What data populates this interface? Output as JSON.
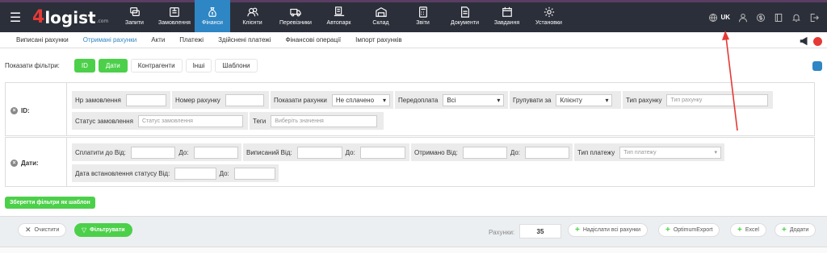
{
  "app": {
    "logo_prefix": "4",
    "logo_name": "logist",
    "logo_suffix": ".com"
  },
  "nav": [
    {
      "label": "Запити",
      "icon": "requests-icon"
    },
    {
      "label": "Замовлення",
      "icon": "orders-icon"
    },
    {
      "label": "Фінанси",
      "icon": "money-bag-icon",
      "active": true
    },
    {
      "label": "Клієнти",
      "icon": "users-icon"
    },
    {
      "label": "Перевізники",
      "icon": "truck-icon"
    },
    {
      "label": "Автопарк",
      "icon": "fleet-icon"
    },
    {
      "label": "Склад",
      "icon": "warehouse-icon"
    },
    {
      "label": "Звіти",
      "icon": "calculator-icon"
    },
    {
      "label": "Документи",
      "icon": "document-icon"
    },
    {
      "label": "Завдання",
      "icon": "calendar-icon"
    },
    {
      "label": "Установки",
      "icon": "gear-icon"
    }
  ],
  "lang": "UK",
  "subnav": [
    {
      "label": "Виписані рахунки"
    },
    {
      "label": "Отримані рахунки",
      "active": true
    },
    {
      "label": "Акти"
    },
    {
      "label": "Платежі"
    },
    {
      "label": "Здійснені платежі"
    },
    {
      "label": "Фінансові операції"
    },
    {
      "label": "Імпорт рахунків"
    }
  ],
  "filters": {
    "label": "Показати фільтри:",
    "chips": [
      {
        "label": "ID",
        "on": true
      },
      {
        "label": "Дати",
        "on": true
      },
      {
        "label": "Контрагенти"
      },
      {
        "label": "Інші"
      },
      {
        "label": "Шаблони"
      }
    ]
  },
  "id_panel": {
    "title": "ID:",
    "order_no_label": "Нр замовлення",
    "invoice_no_label": "Номер рахунку",
    "show_invoices_label": "Показати рахунки",
    "show_invoices_value": "Не сплачено",
    "prepay_label": "Передоплата",
    "prepay_value": "Всі",
    "group_by_label": "Групувати за",
    "group_by_value": "Клієнту",
    "invoice_type_label": "Тип рахунку",
    "invoice_type_placeholder": "Тип рахунку",
    "order_status_label": "Статус замовлення",
    "order_status_placeholder": "Статус замовлення",
    "tags_label": "Теги",
    "tags_placeholder": "Виберіть значення"
  },
  "dates_panel": {
    "title": "Дати:",
    "paid_until_label": "Сплатити до Від:",
    "to_label": "До:",
    "issued_label": "Виписаний Від:",
    "received_label": "Отримано Від:",
    "payment_type_label": "Тип платежу",
    "payment_type_placeholder": "Тип платежу",
    "status_date_label": "Дата встановлення статусу Від:"
  },
  "save_template": "Зберегти фільтри як шаблон",
  "bottom": {
    "clear": "Очистити",
    "filter": "Фільтрувати",
    "count_label": "Рахунки:",
    "count_value": "35",
    "send_all": "Надіслати всі рахунки",
    "optimum": "OptimumExport",
    "excel": "Excel",
    "add": "Додати"
  },
  "colors": {
    "topbar": "#2b2f3a",
    "active_tab": "#2f86c4",
    "accent_green": "#4cd04a",
    "arrow": "#e53935"
  }
}
